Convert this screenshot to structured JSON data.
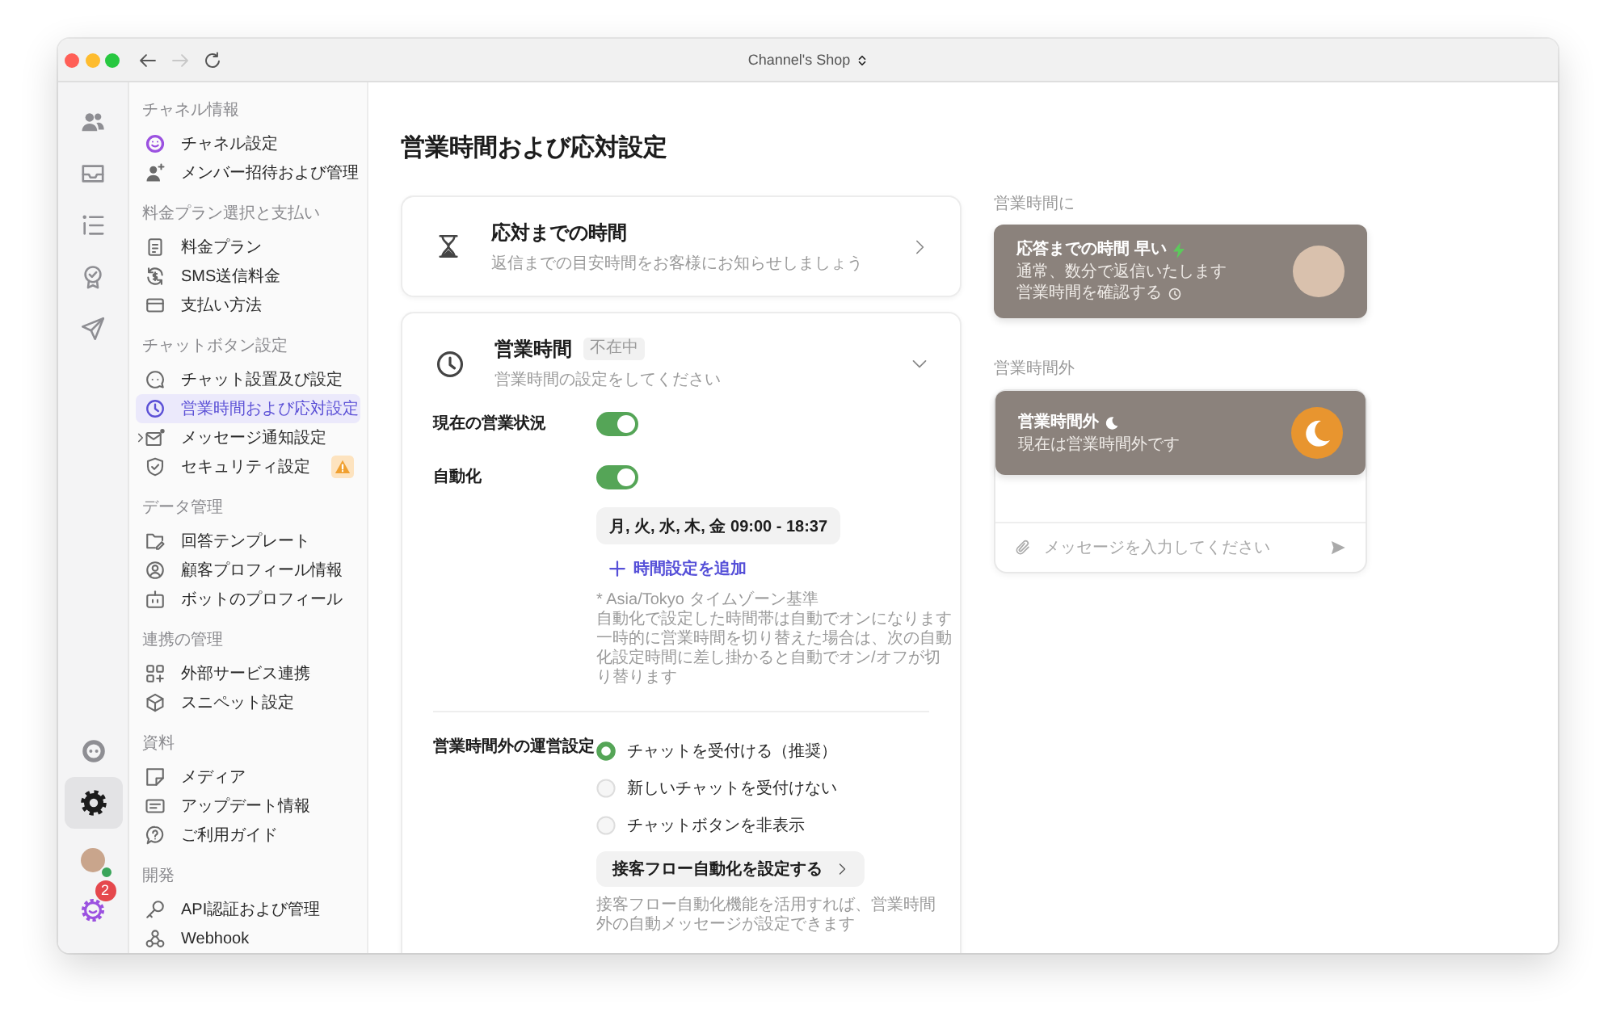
{
  "window": {
    "title": "Channel's Shop",
    "nav_buttons": [
      {
        "disabled": false
      },
      {
        "disabled": true
      },
      {
        "disabled": false
      }
    ]
  },
  "rail": {
    "top": [
      {
        "selected": false
      },
      {
        "selected": false
      },
      {
        "selected": false
      },
      {
        "selected": false
      },
      {
        "selected": false
      }
    ],
    "bottom": [
      {
        "selected": false
      },
      {
        "selected": true
      }
    ],
    "avatar": {
      "online": true
    },
    "app": {
      "badge": "2"
    }
  },
  "sidebar": {
    "sections": [
      {
        "heading": "チャネル情報",
        "items": [
          {
            "label": "チャネル設定",
            "selected": false
          },
          {
            "label": "メンバー招待および管理",
            "selected": false
          }
        ]
      },
      {
        "heading": "料金プラン選択と支払い",
        "items": [
          {
            "label": "料金プラン",
            "selected": false
          },
          {
            "label": "SMS送信料金",
            "selected": false
          },
          {
            "label": "支払い方法",
            "selected": false
          }
        ]
      },
      {
        "heading": "チャットボタン設定",
        "items": [
          {
            "label": "チャット設置及び設定",
            "selected": false
          },
          {
            "label": "営業時間および応対設定",
            "selected": true
          },
          {
            "label": "メッセージ通知設定",
            "selected": false,
            "expanded": false
          },
          {
            "label": "セキュリティ設定",
            "selected": false,
            "warning": true
          }
        ]
      },
      {
        "heading": "データ管理",
        "items": [
          {
            "label": "回答テンプレート",
            "selected": false
          },
          {
            "label": "顧客プロフィール情報",
            "selected": false
          },
          {
            "label": "ボットのプロフィール",
            "selected": false
          }
        ]
      },
      {
        "heading": "連携の管理",
        "items": [
          {
            "label": "外部サービス連携",
            "selected": false
          },
          {
            "label": "スニペット設定",
            "selected": false
          }
        ]
      },
      {
        "heading": "資料",
        "items": [
          {
            "label": "メディア",
            "selected": false
          },
          {
            "label": "アップデート情報",
            "selected": false
          },
          {
            "label": "ご利用ガイド",
            "selected": false
          }
        ]
      },
      {
        "heading": "開発",
        "items": [
          {
            "label": "API認証および管理",
            "selected": false
          },
          {
            "label": "Webhook",
            "selected": false
          }
        ]
      }
    ]
  },
  "page": {
    "title": "営業時間および応対設定"
  },
  "response_time": {
    "title": "応対までの時間",
    "subtitle": "返信までの目安時間をお客様にお知らせしましょう",
    "expanded": false
  },
  "business_hours": {
    "title": "営業時間",
    "badge": "不在中",
    "subtitle": "営業時間の設定をしてください",
    "expanded": true,
    "toggles": [
      {
        "label": "現在の営業状況",
        "on": true
      },
      {
        "label": "自動化",
        "on": true
      }
    ],
    "schedules": [
      "月, 火, 水, 木, 金 09:00 - 18:37"
    ],
    "add_schedule": "時間設定を追加",
    "timezone_note": "* Asia/Tokyo タイムゾーン基準",
    "notes": [
      "自動化で設定した時間帯は自動でオンになります",
      "一時的に営業時間を切り替えた場合は、次の自動化設定時間に差し掛かると自動でオン/オフが切り替ります"
    ],
    "after_hours": {
      "label": "営業時間外の運営設定",
      "options": [
        {
          "label": "チャットを受付ける（推奨）",
          "selected": true
        },
        {
          "label": "新しいチャットを受付けない",
          "selected": false
        },
        {
          "label": "チャットボタンを非表示",
          "selected": false
        }
      ],
      "button": "接客フロー自動化を設定する",
      "help": "接客フロー自動化機能を活用すれば、営業時間外の自動メッセージが設定できます"
    }
  },
  "preview": {
    "in_hours": {
      "label": "営業時間に",
      "title": "応答までの時間 早い",
      "subtitle": "通常、数分で返信いたします",
      "link": "営業時間を確認する"
    },
    "out_of_hours": {
      "label": "営業時間外",
      "title": "営業時間外",
      "subtitle": "現在は営業時間外です"
    },
    "composer": {
      "placeholder": "メッセージを入力してください"
    }
  }
}
